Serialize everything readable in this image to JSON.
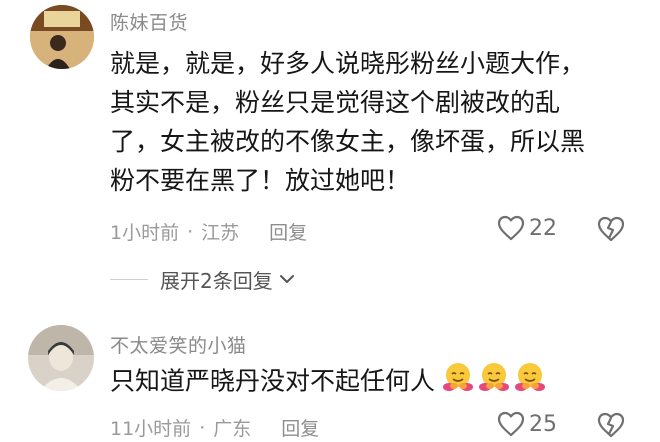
{
  "comments": [
    {
      "author": "陈妹百货",
      "lines": [
        "就是，就是，好多人说晓彤粉丝小题大作，",
        "其实不是，粉丝只是觉得这个剧被改的乱",
        "了，女主被改的不像女主，像坏蛋，所以黑",
        "粉不要在黑了！放过她吧！"
      ],
      "time": "1小时前",
      "location": "江苏",
      "reply_label": "回复",
      "likes": "22"
    },
    {
      "author": "不太爱笑的小猫",
      "lines": [
        "只知道严晓丹没对不起任何人"
      ],
      "emojis": [
        "hugging-face-icon",
        "hugging-face-icon",
        "hugging-face-icon"
      ],
      "time": "11小时前",
      "location": "广东",
      "reply_label": "回复",
      "likes": "25"
    }
  ],
  "expand_replies": {
    "label": "展开2条回复"
  },
  "meta_separator": "·",
  "icons": {
    "like": "heart-outline-icon",
    "dislike": "broken-heart-icon",
    "expand": "chevron-down-icon"
  },
  "colors": {
    "text": "#161616",
    "muted": "#9a9a9a",
    "author": "#8a8a8a"
  }
}
